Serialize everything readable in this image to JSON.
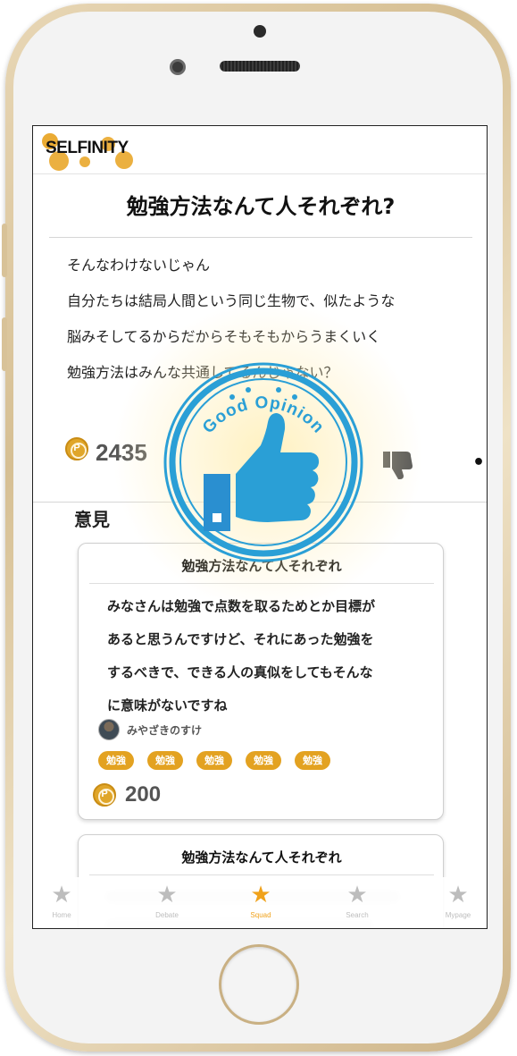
{
  "app": {
    "logo_text": "SELFINITY"
  },
  "post": {
    "title": "勉強方法なんて人それぞれ?",
    "body": [
      "そんなわけないじゃん",
      "自分たちは結局人間という同じ生物で、似たような",
      "脳みそしてるからだからそもそもからうまくいく",
      "勉強方法はみんな共通してるんじゃない？"
    ],
    "points": "2435",
    "more_label": "•••"
  },
  "section": {
    "title": "意見"
  },
  "opinions": [
    {
      "title": "勉強方法なんて人それぞれ",
      "body": [
        "みなさんは勉強で点数を取るためとか目標が",
        "あると思うんですけど、それにあった勉強を",
        "するべきで、できる人の真似をしてもそんな",
        "に意味がないですね"
      ],
      "author": "みやざきのすけ",
      "tags": [
        "勉強",
        "勉強",
        "勉強",
        "勉強",
        "勉強"
      ],
      "points": "200"
    },
    {
      "title": "勉強方法なんて人それぞれ"
    }
  ],
  "coin_symbol": "P",
  "stamp": {
    "text": "Good Opinion",
    "color": "#2a9fd6",
    "icon": "thumbs-up-icon"
  },
  "tabbar": {
    "tabs": [
      {
        "label": "Home",
        "icon": "star-icon",
        "active": false
      },
      {
        "label": "Debate",
        "icon": "star-icon",
        "active": false
      },
      {
        "label": "Squad",
        "icon": "star-icon",
        "active": true
      },
      {
        "label": "Search",
        "icon": "star-icon",
        "active": false
      },
      {
        "label": "Mypage",
        "icon": "star-icon",
        "active": false
      }
    ]
  },
  "colors": {
    "accent": "#f0a21b",
    "tag": "#e3a221",
    "coin": "#e0a62a",
    "frame": "#d6bf93"
  }
}
